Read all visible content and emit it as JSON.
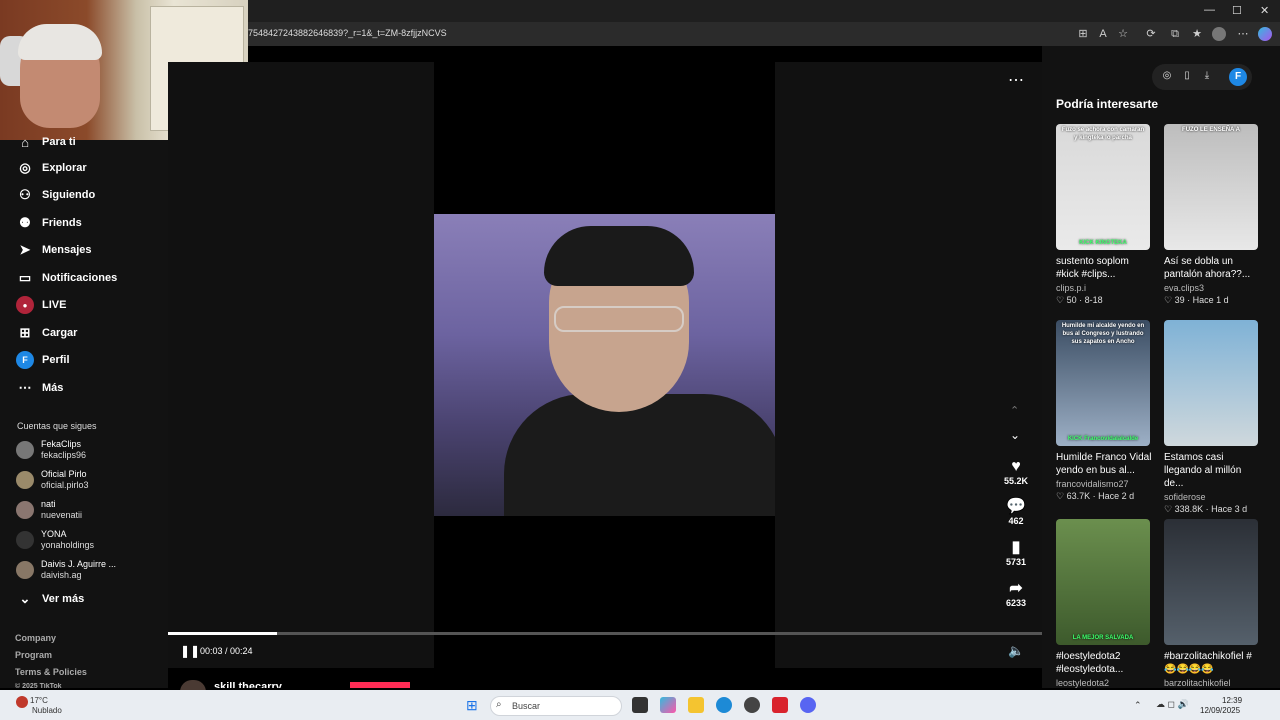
{
  "browser": {
    "url": "7548427243882646839?_r=1&_t=ZM-8zfjjzNCVS",
    "window_controls": [
      "—",
      "☐",
      "✕"
    ]
  },
  "sidebar": {
    "items": [
      {
        "label": "Para ti",
        "icon": "home-icon"
      },
      {
        "label": "Explorar",
        "icon": "compass-icon"
      },
      {
        "label": "Siguiendo",
        "icon": "following-icon"
      },
      {
        "label": "Friends",
        "icon": "friends-icon"
      },
      {
        "label": "Mensajes",
        "icon": "send-icon"
      },
      {
        "label": "Notificaciones",
        "icon": "inbox-icon"
      },
      {
        "label": "LIVE",
        "icon": "live-icon"
      },
      {
        "label": "Cargar",
        "icon": "upload-icon"
      },
      {
        "label": "Perfil",
        "icon": "profile-icon"
      },
      {
        "label": "Más",
        "icon": "more-icon"
      }
    ],
    "following_header": "Cuentas que sigues",
    "accounts": [
      {
        "name": "FekaClips",
        "handle": "fekaclips96"
      },
      {
        "name": "Oficial Pirlo",
        "handle": "oficial.pirlo3"
      },
      {
        "name": "nati",
        "handle": "nuevenatii"
      },
      {
        "name": "YONA",
        "handle": "yonaholdings"
      },
      {
        "name": "Daivis J. Aguirre ...",
        "handle": "daivish.ag"
      }
    ],
    "see_more": "Ver más",
    "footer": [
      "Company",
      "Program",
      "Terms & Policies",
      "© 2025 TikTok"
    ],
    "profile_initial": "F"
  },
  "video": {
    "time": "00:03 / 00:24",
    "progress": 0.125,
    "likes": "55.2K",
    "comments": "462",
    "saves": "5731",
    "shares": "6233",
    "author": "skill.thecarry"
  },
  "suggestions": {
    "title": "Podría interesarte",
    "cards": [
      {
        "title": "sustento soplom #kick #clips...",
        "user": "clips.p.i",
        "stats": "♡ 50 · 8-18",
        "overlay": "Fuzo se achora con camaran y kingteka lo parcha",
        "caption": "KICK KINGTEKA",
        "colors": [
          "#d9d9d9",
          "#eaeaea"
        ]
      },
      {
        "title": "Así se dobla un pantalón ahora??...",
        "user": "eva.clips3",
        "stats": "♡ 39 · Hace 1 d",
        "overlay": "FUZO LE ENSEÑA A",
        "caption": "",
        "colors": [
          "#bdbdbd",
          "#e8e8e8"
        ]
      },
      {
        "title": "Humilde Franco Vidal yendo en bus al...",
        "user": "francovidalismo27",
        "stats": "♡ 63.7K · Hace 2 d",
        "overlay": "Humilde mi alcalde yendo en bus al Congreso y lustrando sus zapatos en Ancho",
        "caption": "KICK Francovidalalcalde",
        "colors": [
          "#3b4d63",
          "#9db0c6"
        ]
      },
      {
        "title": "Estamos casi llegando al millón de...",
        "user": "sofiderose",
        "stats": "♡ 338.8K · Hace 3 d",
        "overlay": "",
        "caption": "",
        "colors": [
          "#7fb2d6",
          "#cfd8dc"
        ]
      },
      {
        "title": "#loestyledota2 #leostyledota...",
        "user": "leostyledota2",
        "stats": "",
        "overlay": "",
        "caption": "LA MEJOR SALVADA",
        "colors": [
          "#6b8f4e",
          "#3d5a2c"
        ]
      },
      {
        "title": "#barzolitachikofiel # 😂😂😂😂",
        "user": "barzolitachikofiel",
        "stats": "",
        "overlay": "",
        "caption": "",
        "colors": [
          "#2b2f36",
          "#55606b"
        ]
      }
    ]
  },
  "taskbar": {
    "temp": "17°C",
    "weather": "Nublado",
    "search_placeholder": "Buscar",
    "time": "12:39",
    "date": "12/09/2025"
  }
}
